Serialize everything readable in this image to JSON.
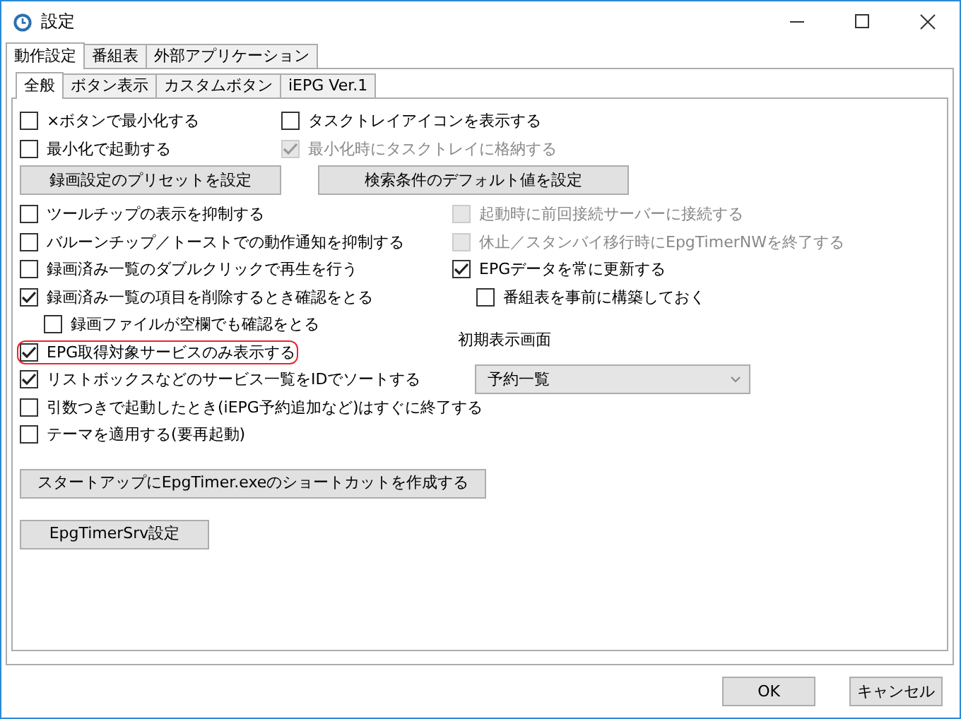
{
  "window": {
    "title": "設定"
  },
  "main_tabs": [
    {
      "label": "動作設定",
      "selected": true
    },
    {
      "label": "番組表",
      "selected": false
    },
    {
      "label": "外部アプリケーション",
      "selected": false
    }
  ],
  "sub_tabs": [
    {
      "label": "全般",
      "selected": true
    },
    {
      "label": "ボタン表示",
      "selected": false
    },
    {
      "label": "カスタムボタン",
      "selected": false
    },
    {
      "label": "iEPG Ver.1",
      "selected": false
    }
  ],
  "top_options": [
    {
      "label": "×ボタンで最小化する",
      "checked": false,
      "disabled": false
    },
    {
      "label": "タスクトレイアイコンを表示する",
      "checked": false,
      "disabled": false
    },
    {
      "label": "最小化で起動する",
      "checked": false,
      "disabled": false
    },
    {
      "label": "最小化時にタスクトレイに格納する",
      "checked": true,
      "disabled": true
    }
  ],
  "top_buttons": [
    "録画設定のプリセットを設定",
    "検索条件のデフォルト値を設定"
  ],
  "left_options": [
    {
      "label": "ツールチップの表示を抑制する",
      "checked": false,
      "disabled": false,
      "highlighted": false
    },
    {
      "label": "バルーンチップ／トーストでの動作通知を抑制する",
      "checked": false,
      "disabled": false,
      "highlighted": false
    },
    {
      "label": "録画済み一覧のダブルクリックで再生を行う",
      "checked": false,
      "disabled": false,
      "highlighted": false
    },
    {
      "label": "録画済み一覧の項目を削除するとき確認をとる",
      "checked": true,
      "disabled": false,
      "highlighted": false,
      "children": [
        {
          "label": "録画ファイルが空欄でも確認をとる",
          "checked": false,
          "disabled": false,
          "highlighted": false
        }
      ]
    },
    {
      "label": "EPG取得対象サービスのみ表示する",
      "checked": true,
      "disabled": false,
      "highlighted": true
    },
    {
      "label": "リストボックスなどのサービス一覧をIDでソートする",
      "checked": true,
      "disabled": false,
      "highlighted": false
    },
    {
      "label": "引数つきで起動したとき(iEPG予約追加など)はすぐに終了する",
      "checked": false,
      "disabled": false,
      "highlighted": false
    },
    {
      "label": "テーマを適用する(要再起動)",
      "checked": false,
      "disabled": false,
      "highlighted": false
    }
  ],
  "right_options": [
    {
      "label": "起動時に前回接続サーバーに接続する",
      "checked": false,
      "disabled": true
    },
    {
      "label": "休止／スタンバイ移行時にEpgTimerNWを終了する",
      "checked": false,
      "disabled": true
    },
    {
      "label": "EPGデータを常に更新する",
      "checked": true,
      "disabled": false,
      "children": [
        {
          "label": "番組表を事前に構築しておく",
          "checked": false,
          "disabled": false
        }
      ]
    }
  ],
  "initial_screen": {
    "label": "初期表示画面",
    "value": "予約一覧"
  },
  "action_buttons": [
    "スタートアップにEpgTimer.exeのショートカットを作成する",
    "EpgTimerSrv設定"
  ],
  "dialog_buttons": [
    "OK",
    "キャンセル"
  ]
}
